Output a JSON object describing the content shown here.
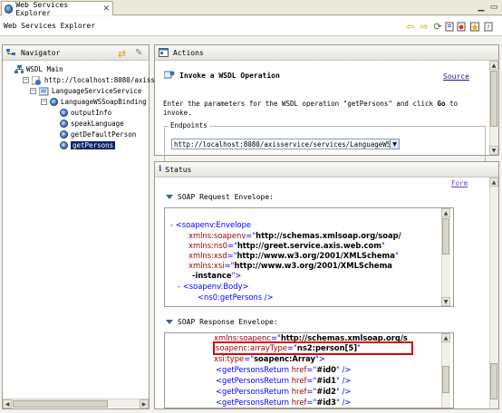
{
  "tab": {
    "label": "Web Services Explorer"
  },
  "header": {
    "title": "Web Services Explorer"
  },
  "navigator": {
    "title": "Navigator",
    "tree": {
      "root": "WSDL Main",
      "url": "http://localhost:8080/axiss",
      "service": "LanguageServiceService",
      "binding": "LanguageWSSoapBinding",
      "operations": [
        "outputInfo",
        "speakLanguage",
        "getDefaultPerson",
        "getPersons"
      ]
    }
  },
  "actions": {
    "title": "Actions",
    "heading": "Invoke a WSDL Operation",
    "source_link": "Source",
    "instructions_before": "Enter the parameters for the WSDL operation \"getPersons\" and click ",
    "instructions_go": "Go",
    "instructions_after": " to invoke.",
    "endpoints_label": "Endpoints",
    "endpoint_value": "http://localhost:8080/axisservice/services/LanguageWS"
  },
  "status": {
    "title": "Status",
    "form_link": "Form",
    "request_label": "SOAP Request Envelope:",
    "response_label": "SOAP Response Envelope:",
    "request_lines": [
      {
        "prefix": "- ",
        "tag": "<soapenv:Envelope"
      },
      {
        "attr": "xmlns:soapenv",
        "val": "http://schemas.xmlsoap.org/soap/"
      },
      {
        "attr": "xmlns:ns0",
        "val": "http://greet.service.axis.web.com",
        "close": "\""
      },
      {
        "attr": "xmlns:xsd",
        "val": "http://www.w3.org/2001/XMLSchema",
        "close": "\""
      },
      {
        "attr": "xmlns:xsi",
        "val": "http://www.w3.org/2001/XMLSchema"
      },
      {
        "cont": "-instance",
        "close": "\">"
      },
      {
        "prefix": "- ",
        "tag": "<soapenv:Body>"
      },
      {
        "tag": "<ns0:getPersons />"
      }
    ],
    "response_lines": [
      {
        "attr": "xmlns:soapenc",
        "val": "http://schemas.xmlsoap.org/s"
      },
      {
        "attr": "soapenc:arrayType",
        "val": "ns2:person[5]",
        "close": "\"",
        "highlight": true
      },
      {
        "attr": "xsi:type",
        "val": "soapenc:Array",
        "close": "\">"
      },
      {
        "tag": "<getPersonsReturn",
        "attr": "href",
        "val": "#id0",
        "close": "\" />"
      },
      {
        "tag": "<getPersonsReturn",
        "attr": "href",
        "val": "#id1",
        "close": "\" />"
      },
      {
        "tag": "<getPersonsReturn",
        "attr": "href",
        "val": "#id2",
        "close": "\" />"
      },
      {
        "tag": "<getPersonsReturn",
        "attr": "href",
        "val": "#id3",
        "close": "\" />"
      }
    ]
  },
  "colors": {
    "selection": "#0a246a",
    "highlight_box": "#dd0000",
    "xml_tag": "#990000",
    "xml_symbol": "#0000ff",
    "link": "#1a1a8c"
  }
}
